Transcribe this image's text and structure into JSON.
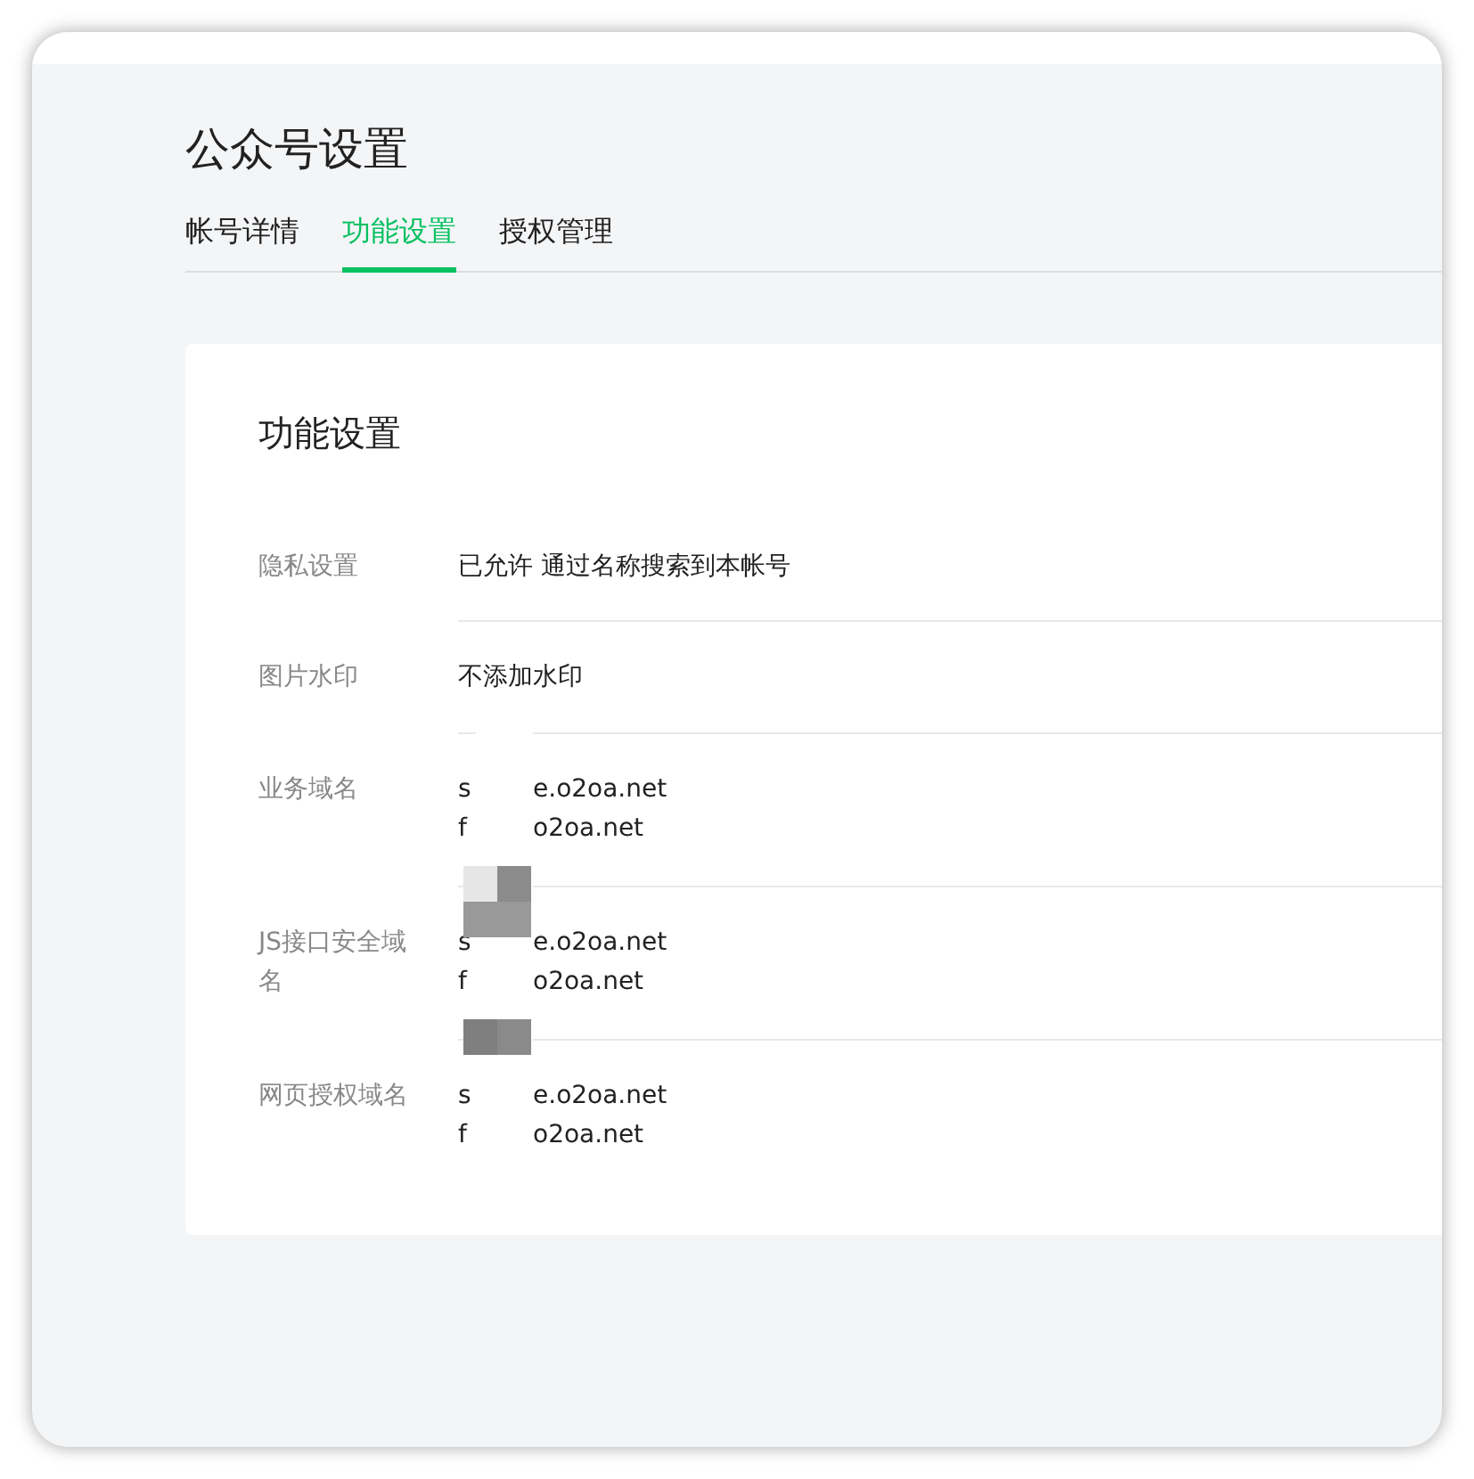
{
  "page_title": "公众号设置",
  "tabs": [
    {
      "label": "帐号详情",
      "selected": false
    },
    {
      "label": "功能设置",
      "selected": true
    },
    {
      "label": "授权管理",
      "selected": false
    }
  ],
  "card": {
    "title": "功能设置",
    "rows": [
      {
        "label": "隐私设置",
        "kind": "text",
        "value": "已允许 通过名称搜索到本帐号"
      },
      {
        "label": "图片水印",
        "kind": "text",
        "value": "不添加水印"
      },
      {
        "label": "业务域名",
        "kind": "domains",
        "domains": [
          {
            "start": "s",
            "end": "e.o2oa.net"
          },
          {
            "start": "f",
            "end": "o2oa.net"
          }
        ]
      },
      {
        "label": "JS接口安全域名",
        "kind": "domains",
        "domains": [
          {
            "start": "s",
            "end": "e.o2oa.net"
          },
          {
            "start": "f",
            "end": "o2oa.net"
          }
        ]
      },
      {
        "label": "网页授权域名",
        "kind": "domains",
        "domains": [
          {
            "start": "s",
            "end": "e.o2oa.net"
          },
          {
            "start": "f",
            "end": "o2oa.net"
          }
        ]
      }
    ]
  }
}
